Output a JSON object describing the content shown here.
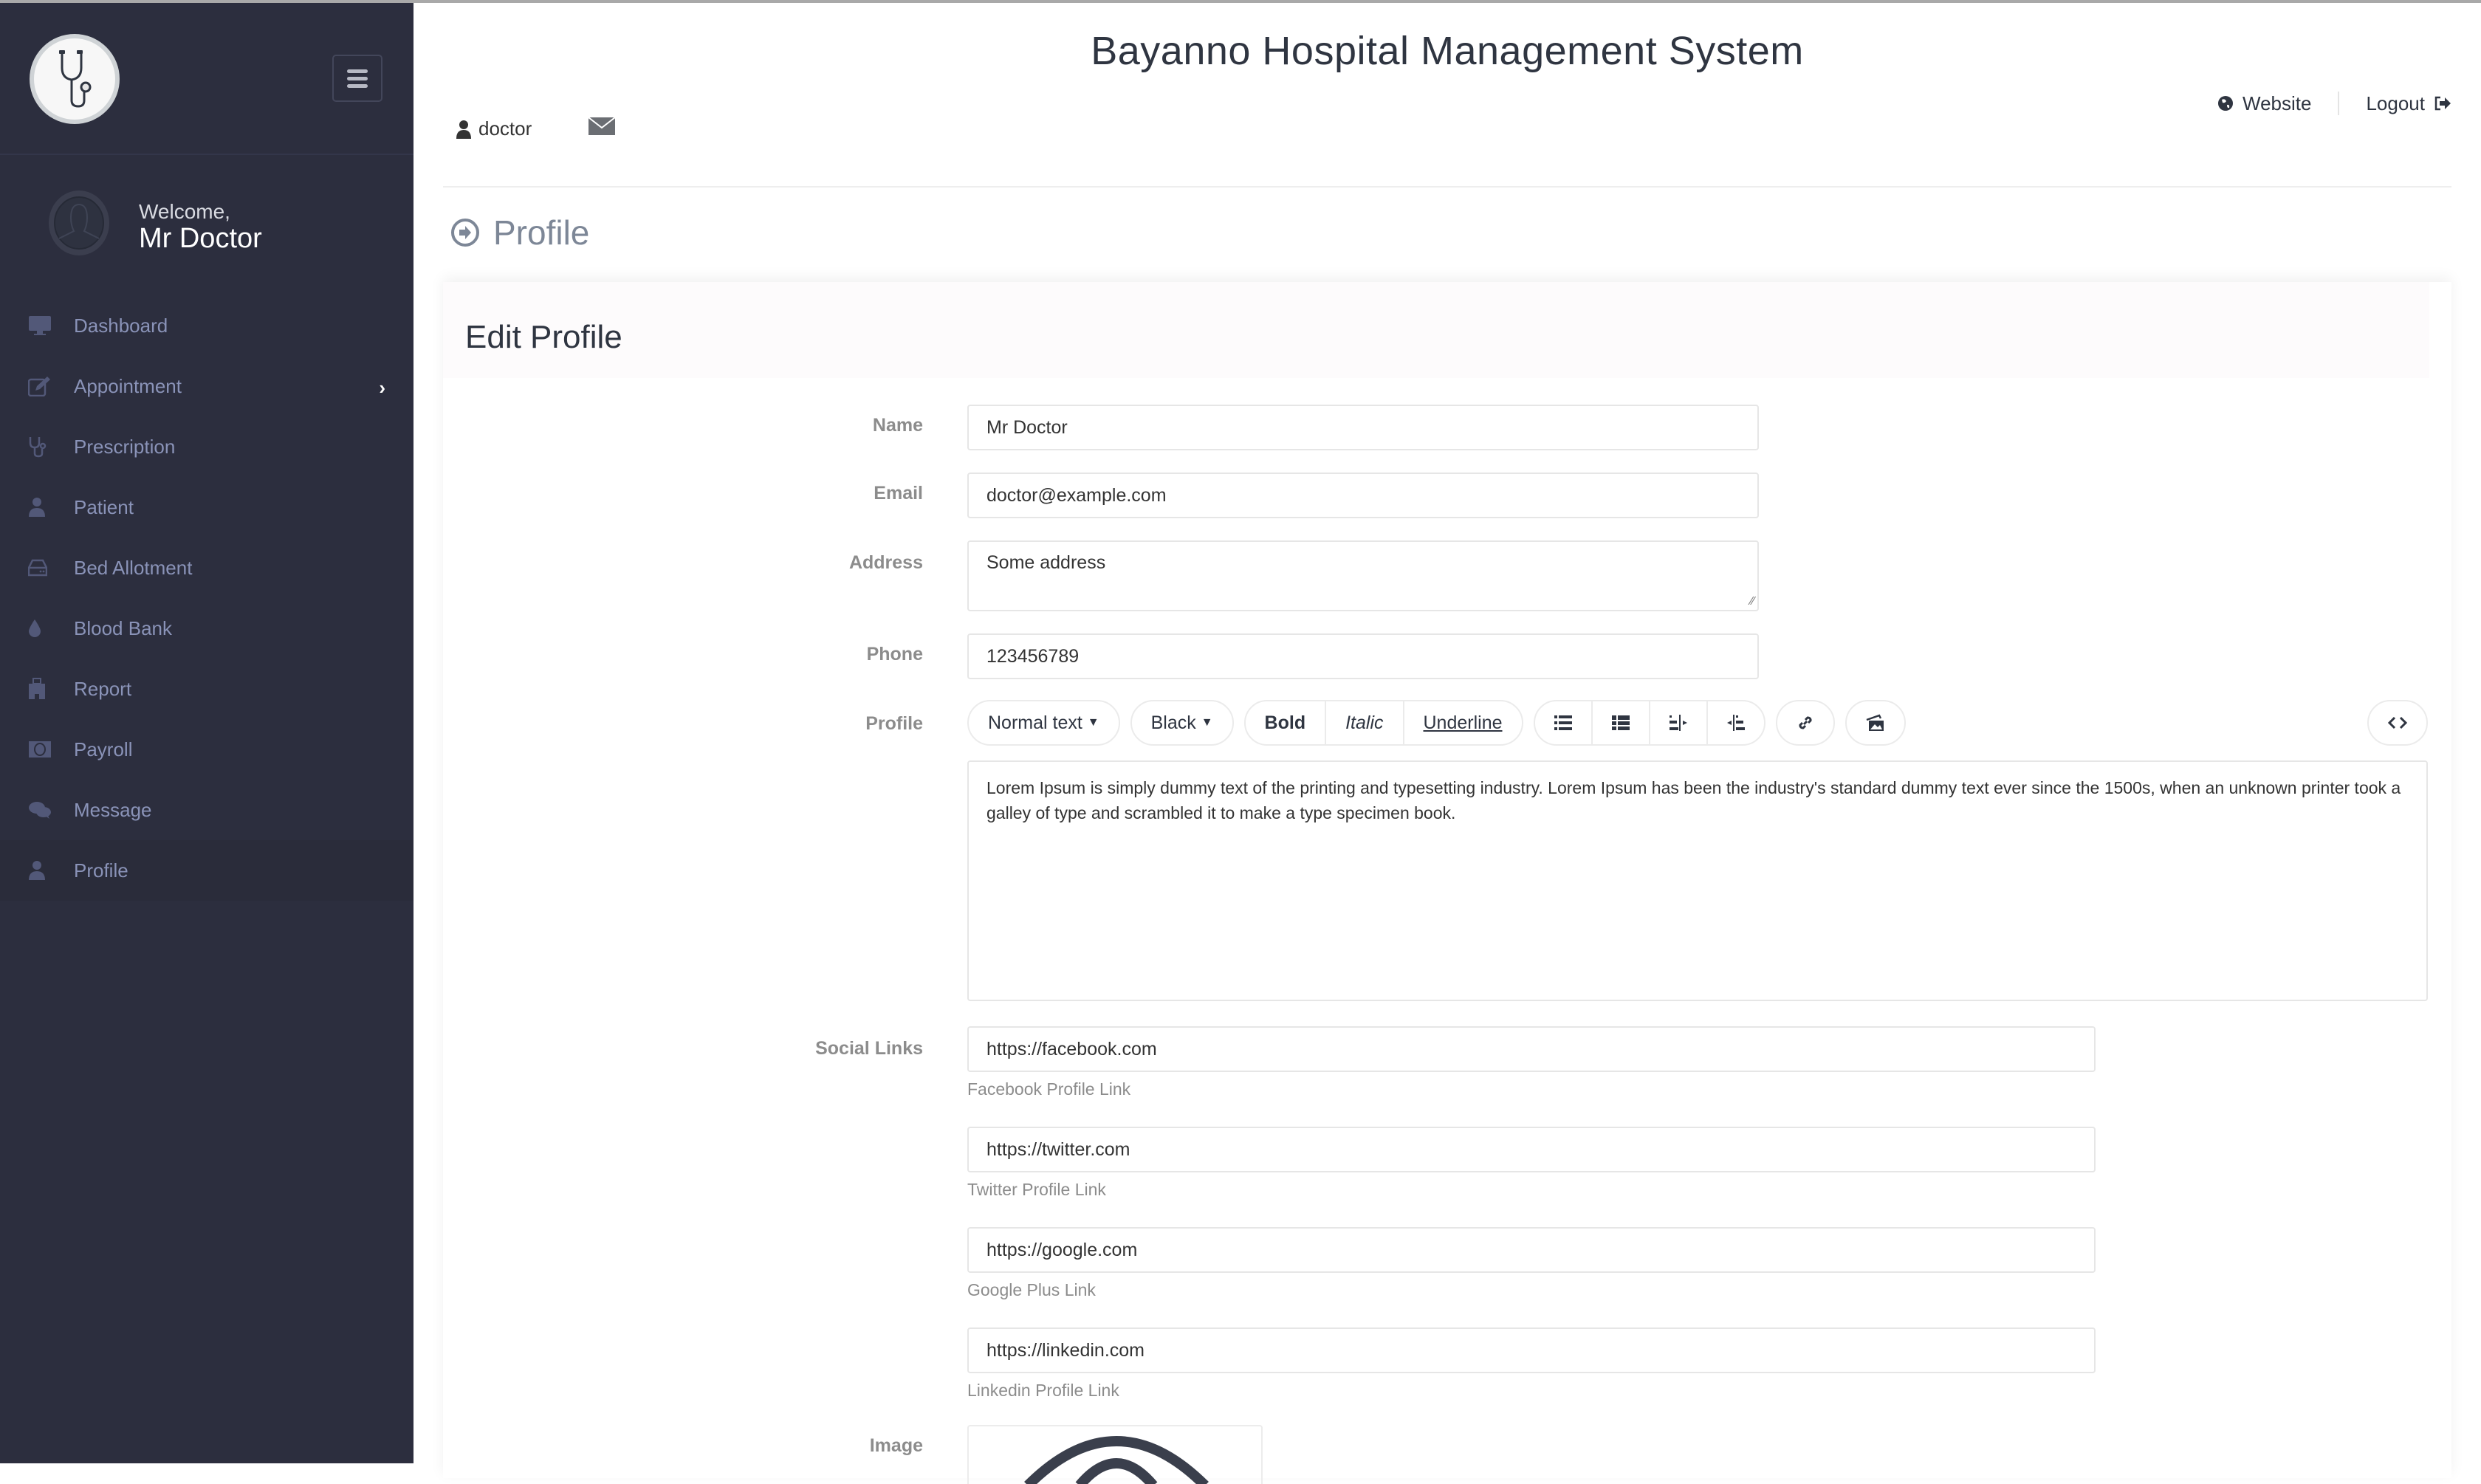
{
  "app": {
    "title": "Bayanno Hospital Management System"
  },
  "sidebar": {
    "welcome_label": "Welcome,",
    "user_name": "Mr Doctor",
    "items": [
      {
        "label": "Dashboard",
        "icon": "desktop-icon"
      },
      {
        "label": "Appointment",
        "icon": "edit-icon",
        "has_submenu": true
      },
      {
        "label": "Prescription",
        "icon": "stethoscope-icon"
      },
      {
        "label": "Patient",
        "icon": "user-icon"
      },
      {
        "label": "Bed Allotment",
        "icon": "hdd-icon"
      },
      {
        "label": "Blood Bank",
        "icon": "tint-icon"
      },
      {
        "label": "Report",
        "icon": "hospital-icon"
      },
      {
        "label": "Payroll",
        "icon": "money-icon"
      },
      {
        "label": "Message",
        "icon": "comments-icon"
      },
      {
        "label": "Profile",
        "icon": "user-icon",
        "active": true
      }
    ]
  },
  "header": {
    "username": "doctor",
    "website_label": "Website",
    "logout_label": "Logout"
  },
  "page": {
    "heading": "Profile",
    "panel_title": "Edit Profile"
  },
  "form": {
    "name_label": "Name",
    "name_value": "Mr Doctor",
    "email_label": "Email",
    "email_value": "doctor@example.com",
    "address_label": "Address",
    "address_value": "Some address",
    "phone_label": "Phone",
    "phone_value": "123456789",
    "profile_label": "Profile",
    "toolbar": {
      "format": "Normal text",
      "color": "Black",
      "bold": "Bold",
      "italic": "Italic",
      "underline": "Underline"
    },
    "profile_text": "Lorem Ipsum is simply dummy text of the printing and typesetting industry. Lorem Ipsum has been the industry's standard dummy text ever since the 1500s, when an unknown printer took a galley of type and scrambled it to make a type specimen book.",
    "social_label": "Social Links",
    "social": [
      {
        "value": "https://facebook.com",
        "help": "Facebook Profile Link"
      },
      {
        "value": "https://twitter.com",
        "help": "Twitter Profile Link"
      },
      {
        "value": "https://google.com",
        "help": "Google Plus Link"
      },
      {
        "value": "https://linkedin.com",
        "help": "Linkedin Profile Link"
      }
    ],
    "image_label": "Image"
  },
  "colors": {
    "sidebar_bg": "#2c2e3e",
    "sidebar_text": "#8a93b8",
    "heading_text": "#2f3541"
  }
}
